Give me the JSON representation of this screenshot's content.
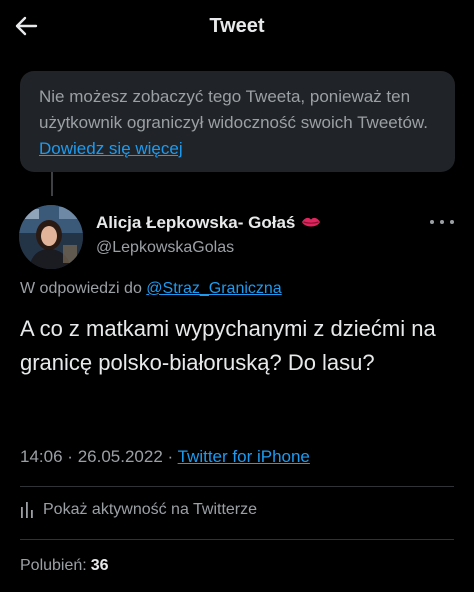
{
  "header": {
    "title": "Tweet",
    "back_icon": "arrow-left-icon"
  },
  "notice": {
    "text": "Nie możesz zobaczyć tego Tweeta, ponieważ ten użytkownik ograniczył widoczność swoich Tweetów.",
    "link": "Dowiedz się więcej"
  },
  "author": {
    "name": "Alicja Łepkowska- Gołaś",
    "name_emoji": "lips-emoji",
    "handle": "@LepkowskaGolas"
  },
  "reply": {
    "prefix": "W odpowiedzi do",
    "mention": "@Straz_Graniczna"
  },
  "tweet": {
    "text": "A co z matkami wypychanymi z dziećmi na granicę polsko-białoruską? Do lasu?"
  },
  "meta": {
    "time": "14:06",
    "separator": "·",
    "date": "26.05.2022",
    "source": "Twitter for iPhone"
  },
  "activity": {
    "label": "Pokaż aktywność na Twitterze"
  },
  "likes": {
    "label": "Polubień:",
    "count": "36"
  },
  "colors": {
    "background": "#000000",
    "accent": "#1d9bf0",
    "secondary_text": "#9ba0a5",
    "notice_bg": "#202327",
    "emoji": "#e0245e"
  }
}
